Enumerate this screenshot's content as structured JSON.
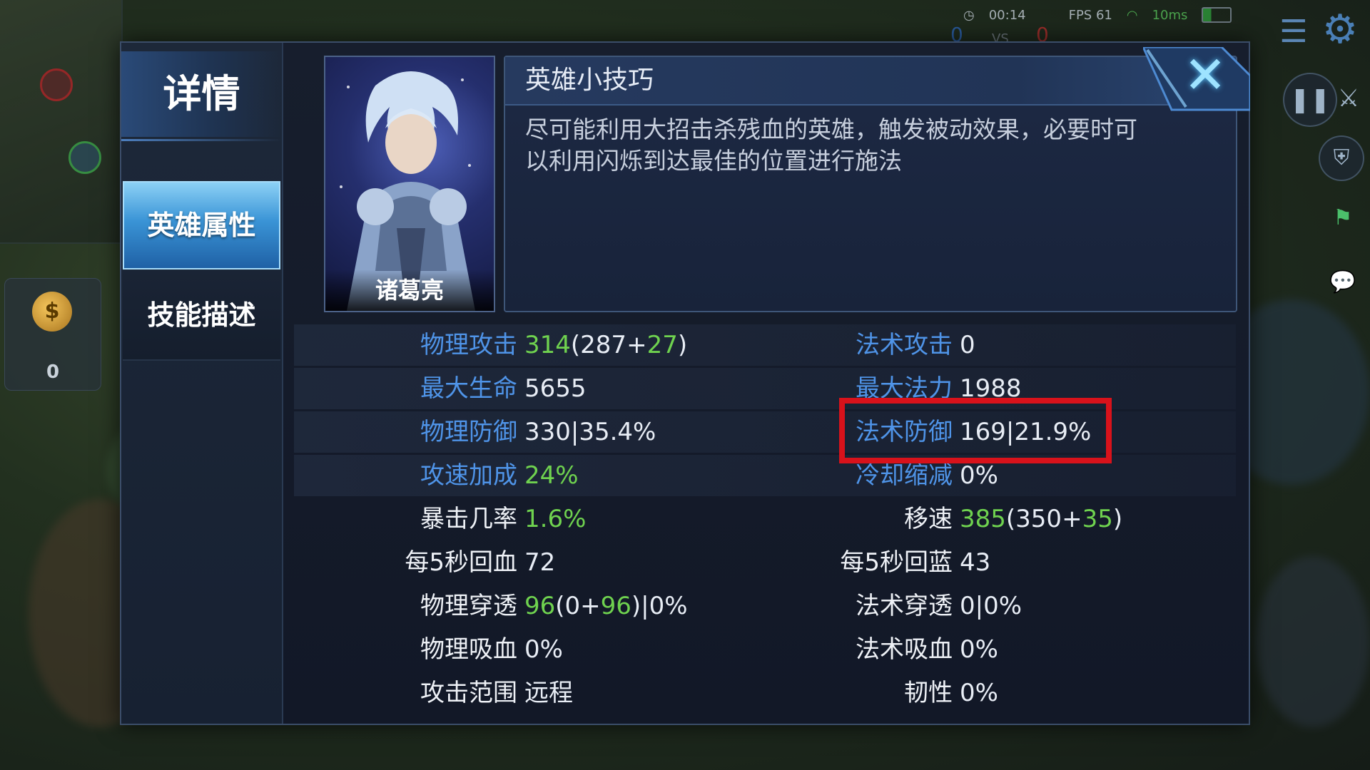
{
  "hud": {
    "time": "00:14",
    "fps": "FPS 61",
    "ping": "10ms",
    "kills_blue": "0",
    "vs": "VS",
    "kills_red": "0",
    "gold": "0"
  },
  "dialog": {
    "title": "详情",
    "tabs": [
      {
        "label": "英雄属性",
        "active": true
      },
      {
        "label": "技能描述",
        "active": false
      }
    ],
    "hero_name": "诸葛亮",
    "tips_title": "英雄小技巧",
    "tips_text": "尽可能利用大招击杀残血的英雄，触发被动效果，必要时可以利用闪烁到达最佳的位置进行施法",
    "close_icon": "close-icon"
  },
  "stats": [
    {
      "left": {
        "label": "物理攻击",
        "label_color": "blue",
        "value": [
          {
            "t": "314",
            "c": "green"
          },
          {
            "t": "(287+",
            "c": "white"
          },
          {
            "t": "27",
            "c": "green"
          },
          {
            "t": ")",
            "c": "white"
          }
        ]
      },
      "right": {
        "label": "法术攻击",
        "label_color": "blue",
        "value": [
          {
            "t": "0",
            "c": "white"
          }
        ]
      }
    },
    {
      "left": {
        "label": "最大生命",
        "label_color": "blue",
        "value": [
          {
            "t": "5655",
            "c": "white"
          }
        ]
      },
      "right": {
        "label": "最大法力",
        "label_color": "blue",
        "value": [
          {
            "t": "1988",
            "c": "white"
          }
        ]
      }
    },
    {
      "left": {
        "label": "物理防御",
        "label_color": "blue",
        "value": [
          {
            "t": "330|35.4%",
            "c": "white"
          }
        ]
      },
      "right": {
        "label": "法术防御",
        "label_color": "blue",
        "value": [
          {
            "t": "169|21.9%",
            "c": "white"
          }
        ]
      }
    },
    {
      "left": {
        "label": "攻速加成",
        "label_color": "blue",
        "value": [
          {
            "t": "24%",
            "c": "green"
          }
        ]
      },
      "right": {
        "label": "冷却缩减",
        "label_color": "blue",
        "value": [
          {
            "t": "0%",
            "c": "white"
          }
        ]
      }
    },
    {
      "left": {
        "label": "暴击几率",
        "label_color": "white",
        "value": [
          {
            "t": "1.6%",
            "c": "green"
          }
        ]
      },
      "right": {
        "label": "移速",
        "label_color": "white",
        "value": [
          {
            "t": "385",
            "c": "green"
          },
          {
            "t": "(350+",
            "c": "white"
          },
          {
            "t": "35",
            "c": "green"
          },
          {
            "t": ")",
            "c": "white"
          }
        ]
      }
    },
    {
      "left": {
        "label": "每5秒回血",
        "label_color": "white",
        "value": [
          {
            "t": "72",
            "c": "white"
          }
        ]
      },
      "right": {
        "label": "每5秒回蓝",
        "label_color": "white",
        "value": [
          {
            "t": "43",
            "c": "white"
          }
        ]
      }
    },
    {
      "left": {
        "label": "物理穿透",
        "label_color": "white",
        "value": [
          {
            "t": "96",
            "c": "green"
          },
          {
            "t": "(0+",
            "c": "white"
          },
          {
            "t": "96",
            "c": "green"
          },
          {
            "t": ")|0%",
            "c": "white"
          }
        ]
      },
      "right": {
        "label": "法术穿透",
        "label_color": "white",
        "value": [
          {
            "t": "0|0%",
            "c": "white"
          }
        ]
      }
    },
    {
      "left": {
        "label": "物理吸血",
        "label_color": "white",
        "value": [
          {
            "t": "0%",
            "c": "white"
          }
        ]
      },
      "right": {
        "label": "法术吸血",
        "label_color": "white",
        "value": [
          {
            "t": "0%",
            "c": "white"
          }
        ]
      }
    },
    {
      "left": {
        "label": "攻击范围",
        "label_color": "white",
        "value": [
          {
            "t": "远程",
            "c": "white"
          }
        ]
      },
      "right": {
        "label": "韧性",
        "label_color": "white",
        "value": [
          {
            "t": "0%",
            "c": "white"
          }
        ]
      }
    }
  ],
  "colors": {
    "label_blue": "#4f94e8",
    "value_green": "#6fd24f",
    "highlight_red": "#d8121b",
    "active_tab": "#3a94d6"
  }
}
